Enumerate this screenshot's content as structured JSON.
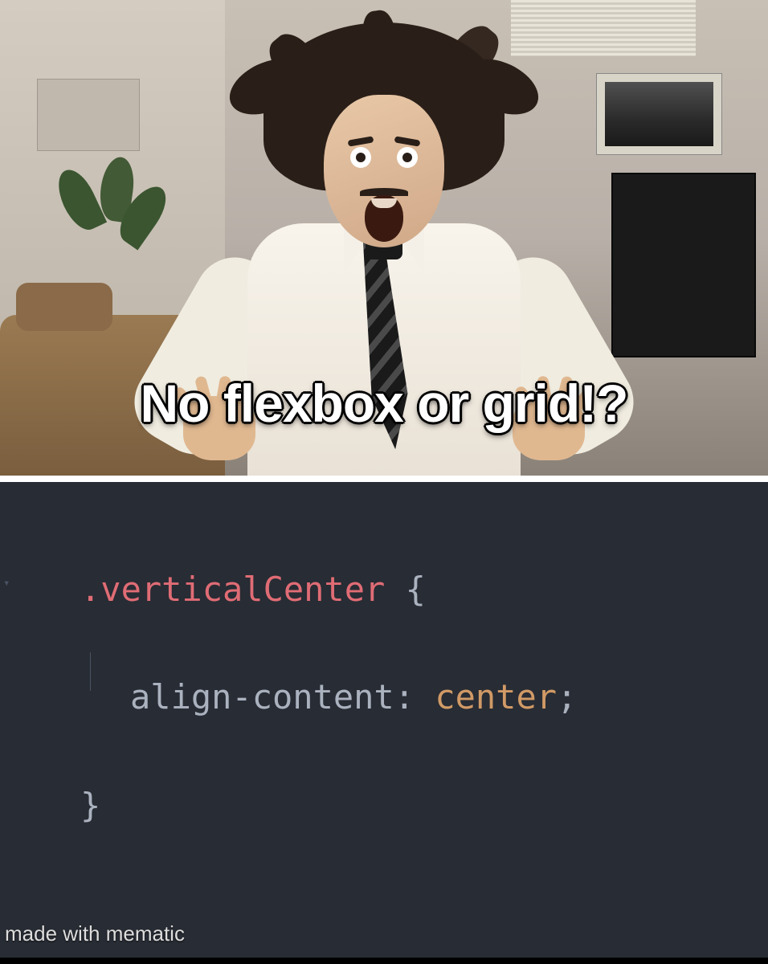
{
  "top": {
    "caption": "No flexbox or grid!?"
  },
  "code": {
    "selector": ".verticalCenter",
    "open_brace": " {",
    "property": "align-content",
    "colon": ": ",
    "value": "center",
    "semi": ";",
    "close_brace": "}"
  },
  "watermark": "made with mematic",
  "gutter_mark": "▾"
}
